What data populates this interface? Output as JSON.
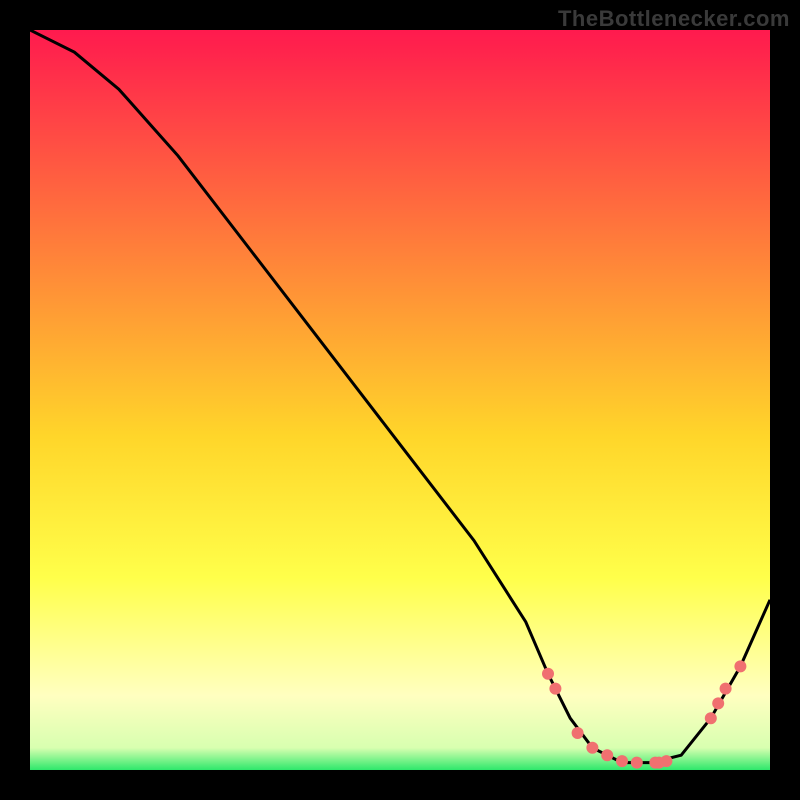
{
  "attribution": "TheBottlenecker.com",
  "colors": {
    "top": "#ff1a4e",
    "upper_mid": "#ff7a3b",
    "mid": "#ffd62a",
    "lower_mid": "#ffff4a",
    "pale": "#ffffc0",
    "green": "#2ee86b",
    "curve": "#000000",
    "marker": "#f07070",
    "background": "#000000"
  },
  "chart_data": {
    "type": "line",
    "title": "",
    "xlabel": "",
    "ylabel": "",
    "xlim": [
      0,
      100
    ],
    "ylim": [
      0,
      100
    ],
    "series": [
      {
        "name": "bottleneck-curve",
        "x": [
          0,
          6,
          12,
          20,
          30,
          40,
          50,
          60,
          67,
          70,
          73,
          76,
          80,
          84,
          88,
          92,
          96,
          100
        ],
        "y": [
          100,
          97,
          92,
          83,
          70,
          57,
          44,
          31,
          20,
          13,
          7,
          3,
          1,
          1,
          2,
          7,
          14,
          23
        ]
      }
    ],
    "markers": {
      "name": "highlight-points",
      "x": [
        70,
        71,
        74,
        76,
        78,
        80,
        82,
        84.5,
        85,
        86,
        92,
        93,
        94,
        96
      ],
      "y": [
        13,
        11,
        5,
        3,
        2,
        1.2,
        1,
        1,
        1,
        1.2,
        7,
        9,
        11,
        14
      ]
    }
  }
}
